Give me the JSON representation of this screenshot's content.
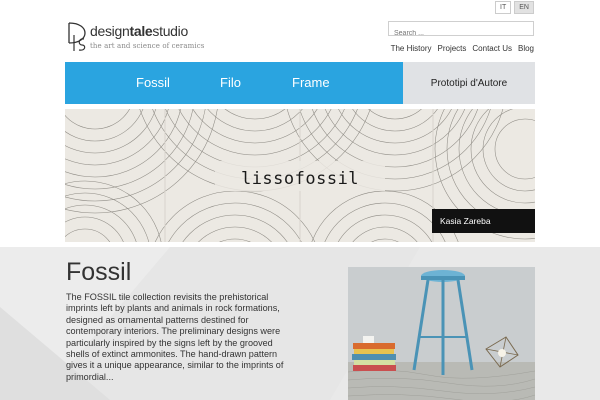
{
  "language_switch": {
    "it": "IT",
    "en": "EN"
  },
  "logo": {
    "name_part1": "design",
    "name_bold": "tale",
    "name_part2": "studio",
    "tagline": "the art and science of ceramics"
  },
  "search": {
    "placeholder": "Search ..."
  },
  "top_links": [
    "The History",
    "Projects",
    "Contact Us",
    "Blog"
  ],
  "main_nav": {
    "items": [
      "Fossil",
      "Filo",
      "Frame"
    ],
    "special": "Prototipi d'Autore"
  },
  "banner": {
    "title": "lissofossil",
    "credit": "Kasia Zareba"
  },
  "content": {
    "title": "Fossil",
    "text": "The FOSSIL tile collection revisits the prehistorical imprints left by plants and animals in rock formations, designed as ornamental patterns destined for contemporary interiors. The preliminary designs were particularly inspired by the signs left by the grooved shells of extinct ammonites. The hand-drawn pattern gives it a unique appearance, similar to the imprints of primordial..."
  },
  "colors": {
    "nav_blue": "#2aa4e0",
    "nav_special_bg": "#e0e2e5",
    "content_bg": "#e6e6e6",
    "stool_blue": "#5aa5c7"
  }
}
